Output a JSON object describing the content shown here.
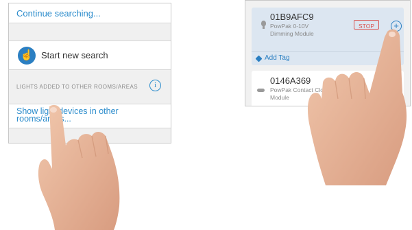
{
  "left_panel": {
    "continue_link": "Continue searching...",
    "start_search_label": "Start new search",
    "section_header": "LIGHTS ADDED TO OTHER ROOMS/AREAS",
    "info_glyph": "i",
    "show_devices_link": "Show light devices in other rooms/areas...",
    "start_search_icon": "pointing-hand-icon"
  },
  "right_panel": {
    "device1": {
      "serial": "01B9AFC9",
      "description": "PowPak 0-10V Dimming Module",
      "stop_label": "STOP",
      "plus_glyph": "+",
      "add_tag_label": "Add Tag",
      "icon": "bulb-icon"
    },
    "device2": {
      "serial": "0146A369",
      "description": "PowPak Contact Closure Module",
      "icon": "toggle-icon"
    }
  },
  "colors": {
    "link": "#2b8ccc",
    "accent": "#2b7fc2",
    "stop": "#d9534f",
    "selected_card": "#dce6f1",
    "section_gray": "#f0f0f0"
  }
}
